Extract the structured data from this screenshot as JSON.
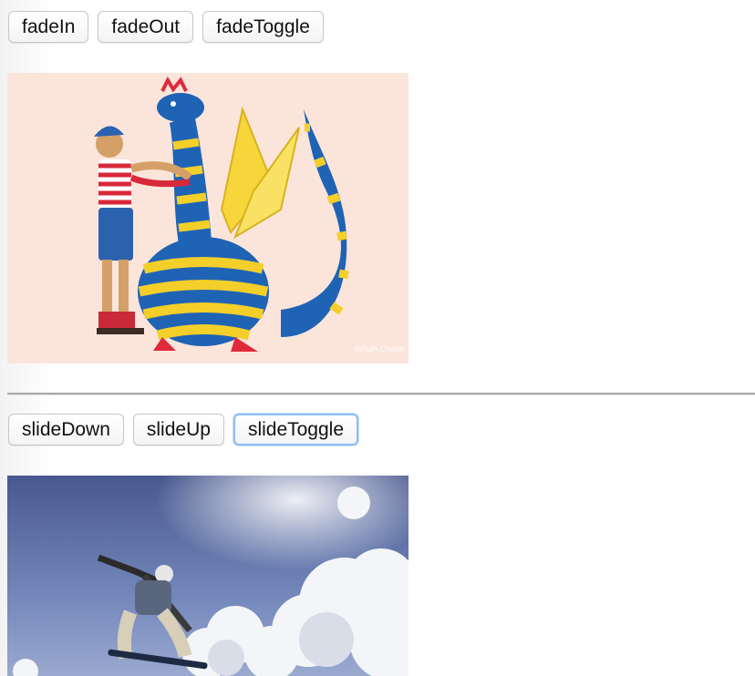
{
  "fade_controls": {
    "fade_in_label": "fadeIn",
    "fade_out_label": "fadeOut",
    "fade_toggle_label": "fadeToggle"
  },
  "slide_controls": {
    "slide_down_label": "slideDown",
    "slide_up_label": "slideUp",
    "slide_toggle_label": "slideToggle"
  },
  "images": {
    "dragon_watermark": "©Ruth Chase"
  },
  "colors": {
    "focus_ring": "#8fbdf0",
    "dragon_background": "#fbe5db",
    "dragon_blue": "#1f63b5",
    "dragon_yellow": "#f4cf2a",
    "sky_blue": "#6f86b8"
  }
}
